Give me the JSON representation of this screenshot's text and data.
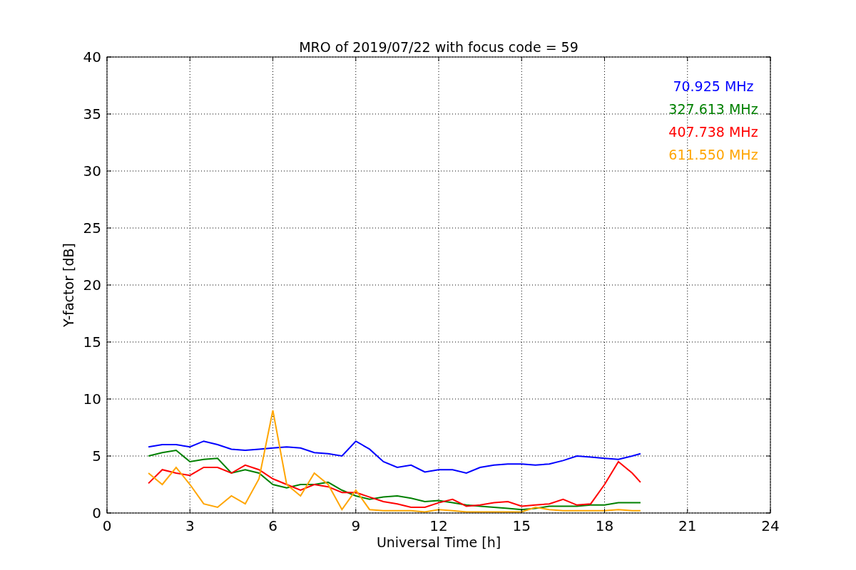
{
  "figure": {
    "chart_data": {
      "type": "line",
      "title": "MRO of 2019/07/22 with focus code = 59",
      "xlabel": "Universal Time [h]",
      "ylabel": "Y-factor [dB]",
      "x": [
        1.5,
        2,
        2.5,
        3,
        3.5,
        4,
        4.5,
        5,
        5.5,
        6,
        6.5,
        7,
        7.5,
        8,
        8.5,
        9,
        9.5,
        10,
        10.5,
        11,
        11.5,
        12,
        12.5,
        13,
        13.5,
        14,
        14.5,
        15,
        15.5,
        16,
        16.5,
        17,
        17.5,
        18,
        18.5,
        19,
        19.3
      ],
      "series": [
        {
          "name": "70.925 MHz",
          "color": "#0000ff",
          "values": [
            5.8,
            6,
            6,
            5.8,
            6.3,
            6,
            5.6,
            5.5,
            5.6,
            5.7,
            5.8,
            5.7,
            5.3,
            5.2,
            5,
            6.3,
            5.6,
            4.5,
            4,
            4.2,
            3.6,
            3.8,
            3.8,
            3.5,
            4,
            4.2,
            4.3,
            4.3,
            4.2,
            4.3,
            4.6,
            5,
            4.9,
            4.8,
            4.7,
            5,
            5.2
          ]
        },
        {
          "name": "327.613 MHz",
          "color": "#008000",
          "values": [
            5,
            5.3,
            5.5,
            4.5,
            4.7,
            4.8,
            3.5,
            3.8,
            3.5,
            2.5,
            2.2,
            2.5,
            2.5,
            2.7,
            2,
            1.5,
            1.2,
            1.4,
            1.5,
            1.3,
            1,
            1.1,
            0.9,
            0.7,
            0.6,
            0.5,
            0.4,
            0.3,
            0.4,
            0.6,
            0.6,
            0.6,
            0.7,
            0.7,
            0.9,
            0.9,
            0.9
          ]
        },
        {
          "name": "407.738 MHz",
          "color": "#ff0000",
          "values": [
            2.6,
            3.8,
            3.5,
            3.3,
            4,
            4,
            3.5,
            4.2,
            3.8,
            3,
            2.5,
            2,
            2.5,
            2.3,
            1.8,
            1.8,
            1.4,
            1,
            0.8,
            0.5,
            0.5,
            0.9,
            1.2,
            0.6,
            0.7,
            0.9,
            1,
            0.6,
            0.7,
            0.8,
            1.2,
            0.7,
            0.8,
            2.5,
            4.5,
            3.5,
            2.7
          ]
        },
        {
          "name": "611.550 MHz",
          "color": "#ffa500",
          "values": [
            3.5,
            2.5,
            4,
            2.5,
            0.8,
            0.5,
            1.5,
            0.8,
            3,
            9,
            2.5,
            1.5,
            3.5,
            2.5,
            0.3,
            2,
            0.3,
            0.2,
            0.2,
            0.2,
            0.1,
            0.3,
            0.2,
            0.1,
            0.1,
            0.1,
            0.1,
            0.1,
            0.5,
            0.3,
            0.2,
            0.2,
            0.2,
            0.2,
            0.3,
            0.2,
            0.2
          ]
        }
      ],
      "grid": true,
      "xlim": [
        0,
        24
      ],
      "ylim": [
        0,
        40
      ],
      "xticks": [
        0,
        3,
        6,
        9,
        12,
        15,
        18,
        21,
        24
      ],
      "yticks": [
        0,
        5,
        10,
        15,
        20,
        25,
        30,
        35,
        40
      ]
    }
  }
}
